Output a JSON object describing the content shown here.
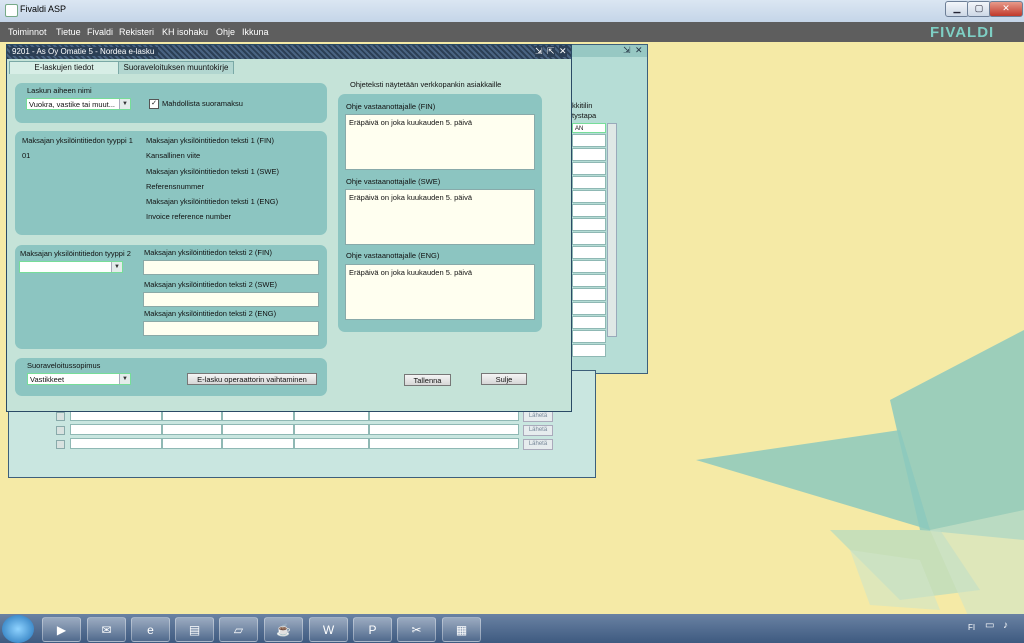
{
  "window": {
    "title": "Fivaldi ASP",
    "btn_min": "▁",
    "btn_max": "▢",
    "btn_close": "✕"
  },
  "brand": {
    "text": "FIVALDI",
    "color": "#7ecfc4"
  },
  "menu": [
    "Toiminnot",
    "Tietue",
    "Fivaldi",
    "Rekisteri",
    "KH isohaku",
    "Ohje",
    "Ikkuna"
  ],
  "bg_window": {
    "col_header_1": "kkitilin",
    "col_header_2": "tystapa",
    "col_value": "AN",
    "row_button": "Lähetä"
  },
  "dialog": {
    "title": "9201 - As Oy Omatie 5 - Nordea e-lasku",
    "tabs": [
      {
        "label": "E-laskujen tiedot",
        "active": true
      },
      {
        "label": "Suoraveloituksen muuntokirje",
        "active": false
      }
    ],
    "invoice_subject": {
      "label": "Laskun aiheen nimi",
      "value": "Vuokra, vastike tai muut...",
      "direct_payment_label": "Mahdollista suoramaksu",
      "direct_payment_checked": true
    },
    "payer_id1": {
      "type_label": "Maksajan yksilöintitiedon tyyppi 1",
      "type_value": "01",
      "text_fin_label": "Maksajan yksilöintitiedon teksti 1 (FIN)",
      "text_fin_value": "Kansallinen viite",
      "text_swe_label": "Maksajan yksilöintitiedon teksti 1 (SWE)",
      "text_swe_value": "Referensnummer",
      "text_eng_label": "Maksajan yksilöintitiedon teksti 1 (ENG)",
      "text_eng_value": "Invoice reference number"
    },
    "payer_id2": {
      "type_label": "Maksajan yksilöintitiedon tyyppi 2",
      "type_value": "",
      "text_fin_label": "Maksajan yksilöintitiedon teksti 2 (FIN)",
      "text_swe_label": "Maksajan yksilöintitiedon teksti 2 (SWE)",
      "text_eng_label": "Maksajan yksilöintitiedon teksti 2 (ENG)"
    },
    "direct_debit": {
      "label": "Suoraveloitussopimus",
      "value": "Vastikkeet",
      "operator_button": "E-lasku operaattorin vaihtaminen"
    },
    "instructions": {
      "heading": "Ohjeteksti näytetään verkkopankin asiakkaille",
      "fin_label": "Ohje vastaanottajalle (FIN)",
      "fin_value": "Eräpäivä on joka kuukauden 5. päivä",
      "swe_label": "Ohje vastaanottajalle (SWE)",
      "swe_value": "Eräpäivä on joka kuukauden 5. päivä",
      "eng_label": "Ohje vastaanottajalle (ENG)",
      "eng_value": "Eräpäivä on joka kuukauden 5. päivä"
    },
    "save_button": "Tallenna",
    "close_button": "Sulje"
  },
  "taskbar": {
    "icons": [
      "media-player-icon",
      "outlook-icon",
      "internet-explorer-icon",
      "file-explorer-icon",
      "folder-icon",
      "java-icon",
      "word-icon",
      "powerpoint-icon",
      "tools-icon",
      "network-icon"
    ],
    "lang": "FI"
  }
}
